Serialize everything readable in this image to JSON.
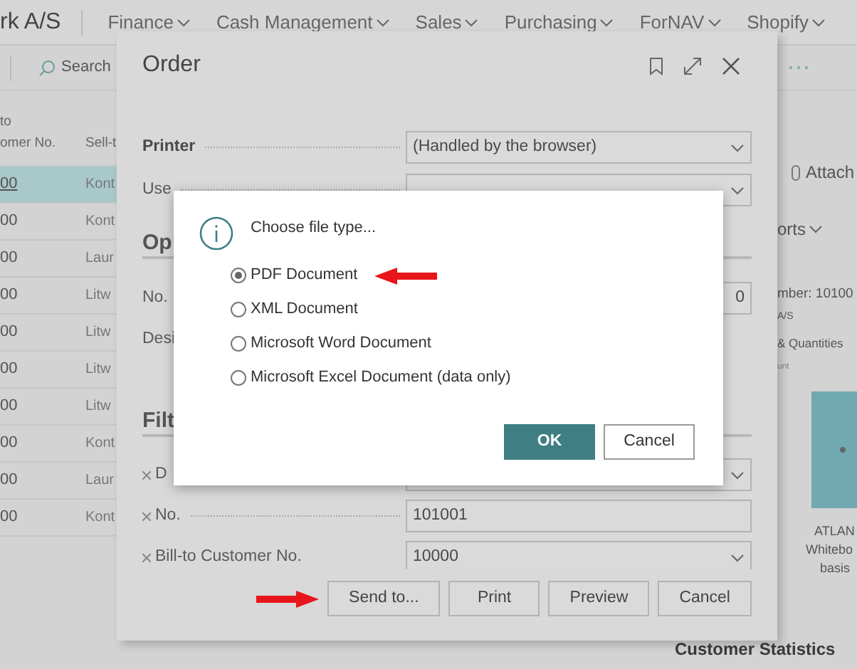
{
  "app": {
    "company": "rk A/S",
    "menu": [
      {
        "label": "Finance"
      },
      {
        "label": "Cash Management"
      },
      {
        "label": "Sales"
      },
      {
        "label": "Purchasing"
      },
      {
        "label": "ForNAV"
      },
      {
        "label": "Shopify"
      }
    ]
  },
  "toolbar": {
    "search": "Search"
  },
  "list": {
    "columns": [
      {
        "lines": [
          "to",
          "omer No."
        ]
      },
      {
        "lines": [
          "Sell-t"
        ]
      }
    ],
    "rows": [
      {
        "number": "00",
        "name": "Kont",
        "selected": true
      },
      {
        "number": "00",
        "name": "Kont",
        "selected": false
      },
      {
        "number": "00",
        "name": "Laur",
        "selected": false
      },
      {
        "number": "00",
        "name": "Litw",
        "selected": false
      },
      {
        "number": "00",
        "name": "Litw",
        "selected": false
      },
      {
        "number": "00",
        "name": "Litw",
        "selected": false
      },
      {
        "number": "00",
        "name": "Litw",
        "selected": false
      },
      {
        "number": "00",
        "name": "Kont",
        "selected": false
      },
      {
        "number": "00",
        "name": "Laur",
        "selected": false
      },
      {
        "number": "00",
        "name": "Kont",
        "selected": false
      }
    ]
  },
  "factbox": {
    "attach": "Attach",
    "reports": "orts",
    "lines": [
      "mber: 10100",
      "A/S",
      "& Quantities",
      "unt"
    ],
    "chart_labels": [
      "ATLAN",
      "Whitebo",
      "basis"
    ],
    "statistics": "Customer Statistics"
  },
  "order_dialog": {
    "title": "Order",
    "rows": [
      {
        "kind": "select",
        "label": "Printer",
        "value": "(Handled by the browser)",
        "removable": false
      },
      {
        "kind": "select",
        "label": "Use",
        "removable": false
      },
      {
        "kind": "heading",
        "label": "Op"
      },
      {
        "kind": "number",
        "label": "No.",
        "value": "0",
        "removable": false
      },
      {
        "kind": "label",
        "label": "Desi",
        "removable": false
      },
      {
        "kind": "heading",
        "label": "Filt"
      },
      {
        "kind": "select",
        "label": "D",
        "removable": true
      },
      {
        "kind": "text",
        "label": "No.",
        "value": "101001",
        "removable": true
      },
      {
        "kind": "select",
        "label": "Bill-to Customer No.",
        "value": "10000",
        "removable": true
      }
    ],
    "buttons": [
      "Send to...",
      "Print",
      "Preview",
      "Cancel"
    ]
  },
  "file_dialog": {
    "title": "Choose file type...",
    "options": [
      {
        "label": "PDF Document",
        "selected": true
      },
      {
        "label": "XML Document",
        "selected": false
      },
      {
        "label": "Microsoft Word Document",
        "selected": false
      },
      {
        "label": "Microsoft Excel Document (data only)",
        "selected": false
      }
    ],
    "buttons": [
      {
        "label": "OK",
        "primary": true
      },
      {
        "label": "Cancel",
        "primary": false
      }
    ]
  }
}
